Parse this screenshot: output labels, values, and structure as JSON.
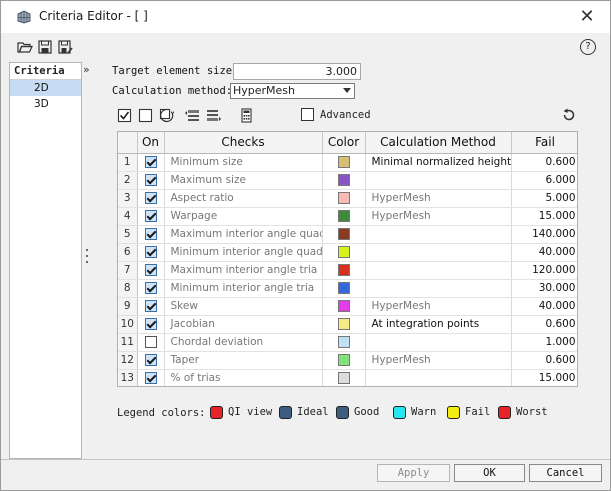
{
  "window": {
    "title": "Criteria Editor - [ ]"
  },
  "toolbar": {
    "icons": [
      "open-folder-icon",
      "save-icon",
      "save-as-icon"
    ],
    "help_label": "?"
  },
  "sidebar": {
    "header": "Criteria",
    "items": [
      {
        "label": "2D",
        "selected": true
      },
      {
        "label": "3D",
        "selected": false
      }
    ],
    "collapse_label": "»"
  },
  "form": {
    "target_size_label": "Target element size:",
    "target_size_value": "3.000",
    "calc_method_label": "Calculation method:",
    "calc_method_value": "HyperMesh",
    "advanced_label": "Advanced"
  },
  "table": {
    "headers": {
      "on": "On",
      "checks": "Checks",
      "color": "Color",
      "method": "Calculation Method",
      "fail": "Fail"
    },
    "rows": [
      {
        "idx": "1",
        "on": true,
        "check": "Minimum size",
        "color": "#d6bf73",
        "method": "Minimal normalized height",
        "method_dark": true,
        "fail": "0.600"
      },
      {
        "idx": "2",
        "on": true,
        "check": "Maximum size",
        "color": "#8a55c6",
        "method": "",
        "method_dark": false,
        "fail": "6.000"
      },
      {
        "idx": "3",
        "on": true,
        "check": "Aspect ratio",
        "color": "#f6b9b4",
        "method": "HyperMesh",
        "method_dark": false,
        "fail": "5.000"
      },
      {
        "idx": "4",
        "on": true,
        "check": "Warpage",
        "color": "#3e8b3a",
        "method": "HyperMesh",
        "method_dark": false,
        "fail": "15.000"
      },
      {
        "idx": "5",
        "on": true,
        "check": "Maximum interior angle quad",
        "color": "#8b3a22",
        "method": "",
        "method_dark": false,
        "fail": "140.000"
      },
      {
        "idx": "6",
        "on": true,
        "check": "Minimum interior angle quad",
        "color": "#d8f21c",
        "method": "",
        "method_dark": false,
        "fail": "40.000"
      },
      {
        "idx": "7",
        "on": true,
        "check": "Maximum interior angle tria",
        "color": "#d8301f",
        "method": "",
        "method_dark": false,
        "fail": "120.000"
      },
      {
        "idx": "8",
        "on": true,
        "check": "Minimum interior angle tria",
        "color": "#3567d8",
        "method": "",
        "method_dark": false,
        "fail": "30.000"
      },
      {
        "idx": "9",
        "on": true,
        "check": "Skew",
        "color": "#e23ce8",
        "method": "HyperMesh",
        "method_dark": false,
        "fail": "40.000"
      },
      {
        "idx": "10",
        "on": true,
        "check": "Jacobian",
        "color": "#f6ea86",
        "method": "At integration points",
        "method_dark": true,
        "fail": "0.600"
      },
      {
        "idx": "11",
        "on": false,
        "check": "Chordal deviation",
        "color": "#bfe0f6",
        "method": "",
        "method_dark": false,
        "fail": "1.000"
      },
      {
        "idx": "12",
        "on": true,
        "check": "Taper",
        "color": "#7de37a",
        "method": "HyperMesh",
        "method_dark": false,
        "fail": "0.600"
      },
      {
        "idx": "13",
        "on": true,
        "check": "% of trias",
        "color": "#dcdcdc",
        "method": "",
        "method_dark": false,
        "fail": "15.000"
      }
    ]
  },
  "legend": {
    "label": "Legend colors:",
    "items": [
      {
        "label": "QI view",
        "color": "#e8242a"
      },
      {
        "label": "Ideal",
        "color": "#3d5e80"
      },
      {
        "label": "Good",
        "color": "#3d5e80"
      },
      {
        "label": "Warn",
        "color": "#27e6ef"
      },
      {
        "label": "Fail",
        "color": "#f6ee12"
      },
      {
        "label": "Worst",
        "color": "#e8242a"
      }
    ]
  },
  "buttons": {
    "apply": "Apply",
    "ok": "OK",
    "cancel": "Cancel"
  }
}
